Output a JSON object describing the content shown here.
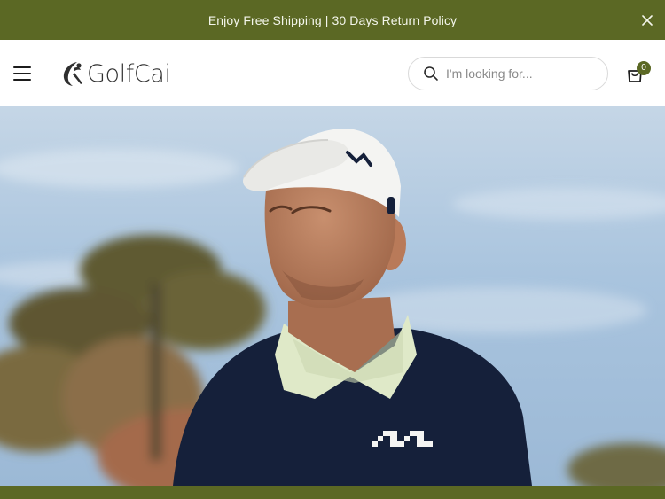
{
  "announcement": {
    "text": "Enjoy Free Shipping | 30 Days Return Policy",
    "close_icon": "close-icon"
  },
  "header": {
    "menu_icon": "hamburger-menu-icon",
    "logo_text": "GolfCai",
    "search": {
      "placeholder": "I'm looking for...",
      "value": "",
      "icon": "search-icon"
    },
    "cart": {
      "icon": "shopping-bag-icon",
      "count": "0"
    }
  },
  "hero": {
    "image": "golfer-in-white-cap-and-navy-sweater-against-sky"
  },
  "colors": {
    "brand_green": "#5b6824",
    "sky_blue": "#a9c4de",
    "navy_sweater": "#15203a"
  }
}
